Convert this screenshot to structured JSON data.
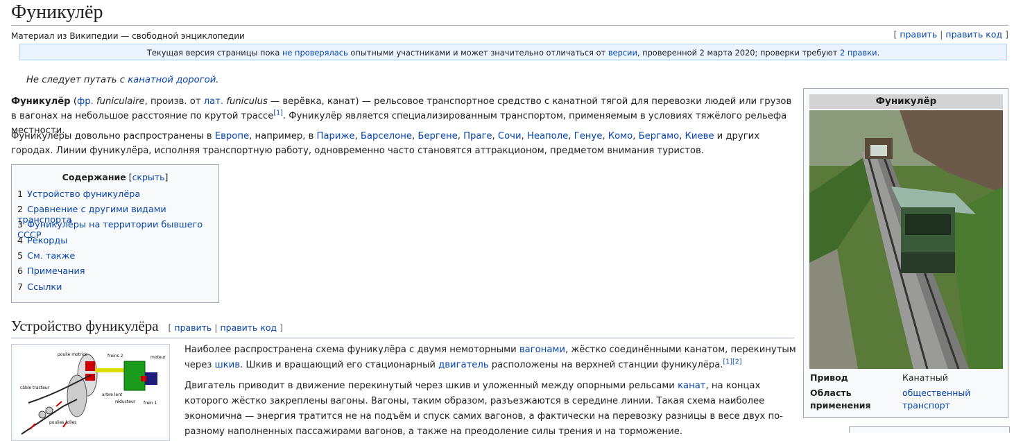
{
  "page": {
    "title": "Фуникулёр",
    "subtitle": "Материал из Википедии — свободной энциклопедии",
    "edit": "править",
    "edit_code": "править код"
  },
  "notice": {
    "t1": "Текущая версия страницы пока ",
    "l1": "не проверялась",
    "t2": " опытными участниками и может значительно отличаться от ",
    "l2": "версии",
    "t3": ", проверенной 2 марта 2020; проверки требуют ",
    "l3": "2 правки",
    "t4": "."
  },
  "hatnote": {
    "text": "Не следует путать с ",
    "link": "канатной дорогой",
    "end": "."
  },
  "intro": {
    "bold": "Фуникулёр",
    "t1": " (",
    "l_fr": "фр.",
    "fr_word": " funiculaire",
    "t2": ", произв. от ",
    "l_lat": "лат.",
    "lat_word": " funiculus",
    "t3": " — верёвка, канат) — рельсовое транспортное средство с канатной тягой для перевозки людей или грузов в вагонах на небольшое расстояние по крутой трассе",
    "ref1": "[1]",
    "t4": ". Фуникулёр является специализированным транспортом, применяемым в условиях тяжёлого рельефа местности."
  },
  "para2": {
    "t1": "Фуникулёры довольно распространены в ",
    "europe": "Европе",
    "t2": ", например, в ",
    "cities": [
      "Париже",
      "Барселоне",
      "Бергене",
      "Праге",
      "Сочи",
      "Неаполе",
      "Генуе",
      "Комо",
      "Бергамо",
      "Киеве"
    ],
    "t3": " и других городах. Линии фуникулёра, исполняя транспортную работу, одновременно часто становятся аттракционом, предметом внимания туристов."
  },
  "toc": {
    "title": "Содержание",
    "toggle": "скрыть",
    "items": [
      {
        "num": "1",
        "label": "Устройство фуникулёра"
      },
      {
        "num": "2",
        "label": "Сравнение с другими видами транспорта"
      },
      {
        "num": "3",
        "label": "Фуникулёры на территории бывшего СССР"
      },
      {
        "num": "4",
        "label": "Рекорды"
      },
      {
        "num": "5",
        "label": "См. также"
      },
      {
        "num": "6",
        "label": "Примечания"
      },
      {
        "num": "7",
        "label": "Ссылки"
      }
    ]
  },
  "section1": {
    "heading": "Устройство фуникулёра",
    "p1_t1": "Наиболее распространена схема фуникулёра с двумя немоторными ",
    "p1_l1": "вагонами",
    "p1_t2": ", жёстко соединёнными канатом, перекинутым через ",
    "p1_l2": "шкив",
    "p1_t3": ". Шкив и вращающий его стационарный ",
    "p1_l3": "двигатель",
    "p1_t4": " расположены на верхней станции фуникулёра.",
    "p1_refs": "[1][2]",
    "p2_t1": "Двигатель приводит в движение перекинутый через шкив и уложенный между опорными рельсами ",
    "p2_l1": "канат",
    "p2_t2": ", на концах которого жёстко закреплены вагоны. Вагоны, таким образом, разъезжаются в середине линии. Такая схема наиболее экономична — энергия тратится не на подъём и спуск самих вагонов, а фактически на перевозку разницы в весе двух по-разному наполненных пассажирами вагонов, а также на преодоление силы трения и на торможение."
  },
  "diagram": {
    "labels": [
      "poulie motrice",
      "freins 2",
      "moteur",
      "câble tracteur",
      "arbre lent",
      "réducteur",
      "frein 1",
      "poulies folles"
    ]
  },
  "infobox": {
    "title": "Фуникулёр",
    "rows": [
      {
        "label": "Привод",
        "value": "Канатный"
      },
      {
        "label": "Область применения",
        "value": "общественный транспорт"
      }
    ]
  }
}
